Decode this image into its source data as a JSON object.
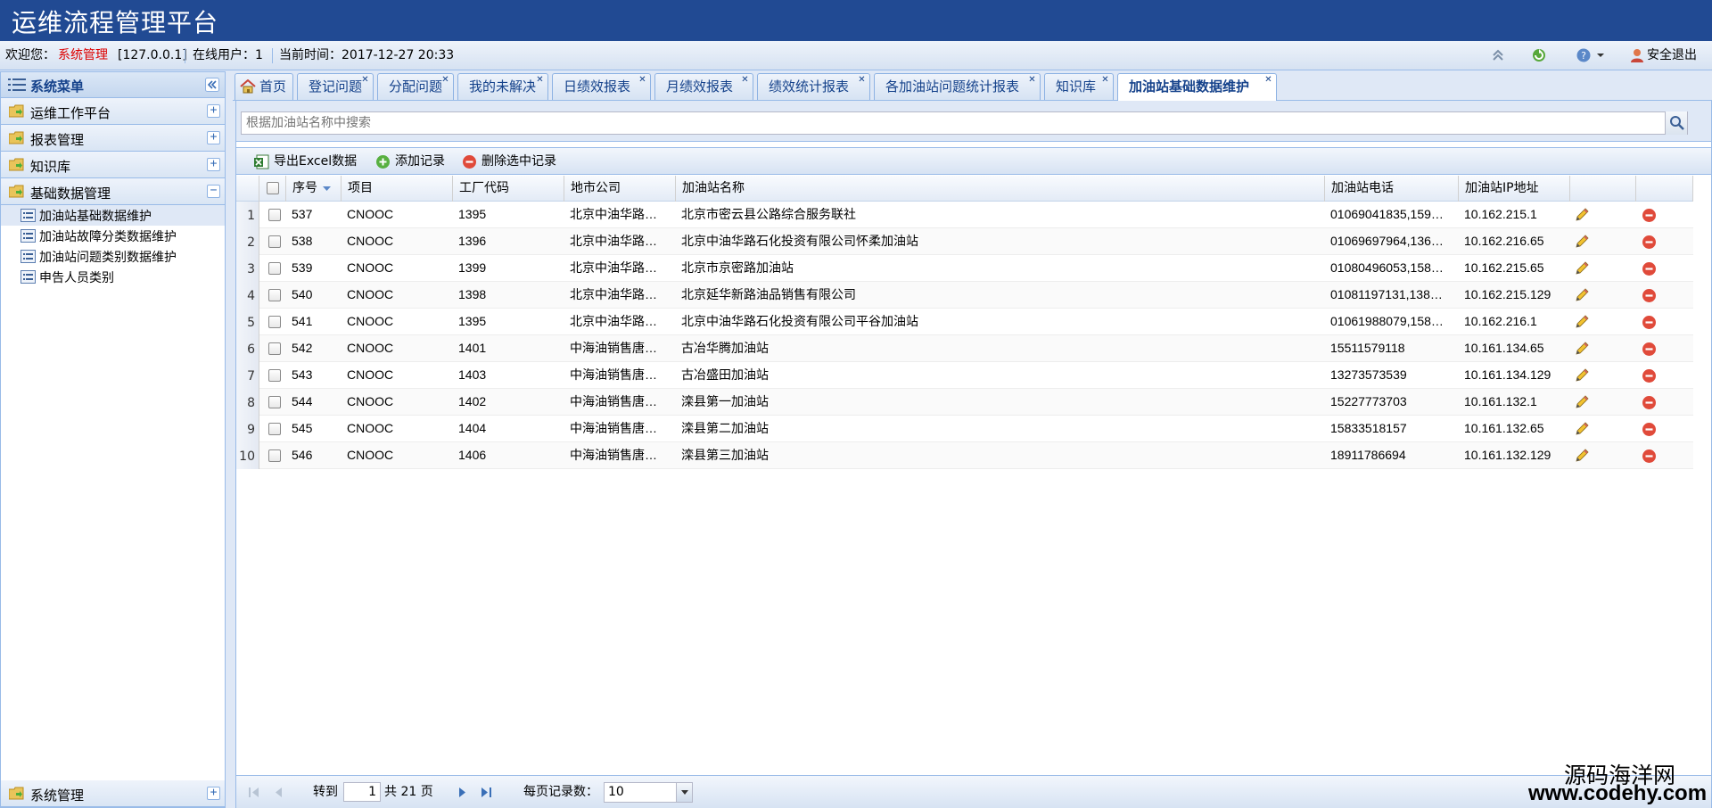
{
  "app": {
    "title": "运维流程管理平台"
  },
  "infobar": {
    "welcome_label": "欢迎您：",
    "user": "系统管理",
    "ip": "[127.0.0.1]",
    "online": "在线用户：1",
    "time": "当前时间：2017-12-27 20:33",
    "logout_label": "安全退出"
  },
  "sidebar": {
    "title": "系统菜单",
    "groups": [
      {
        "label": "运维工作平台",
        "toggle": "+"
      },
      {
        "label": "报表管理",
        "toggle": "+"
      },
      {
        "label": "知识库",
        "toggle": "+"
      },
      {
        "label": "基础数据管理",
        "toggle": "−"
      }
    ],
    "tree": [
      {
        "label": "加油站基础数据维护"
      },
      {
        "label": "加油站故障分类数据维护"
      },
      {
        "label": "加油站问题类别数据维护"
      },
      {
        "label": "申告人员类别"
      }
    ],
    "bottom_group": {
      "label": "系统管理",
      "toggle": "+"
    }
  },
  "tabs": [
    {
      "label": "首页"
    },
    {
      "label": "登记问题"
    },
    {
      "label": "分配问题"
    },
    {
      "label": "我的未解决"
    },
    {
      "label": "日绩效报表"
    },
    {
      "label": "月绩效报表"
    },
    {
      "label": "绩效统计报表"
    },
    {
      "label": "各加油站问题统计报表"
    },
    {
      "label": "知识库"
    },
    {
      "label": "加油站基础数据维护",
      "active": true
    }
  ],
  "search": {
    "placeholder": "根据加油站名称中搜索"
  },
  "toolbar": {
    "export_label": "导出Excel数据",
    "add_label": "添加记录",
    "delete_label": "删除选中记录"
  },
  "grid": {
    "columns": [
      "序号",
      "项目",
      "工厂代码",
      "地市公司",
      "加油站名称",
      "加油站电话",
      "加油站IP地址"
    ],
    "rows": [
      {
        "n": "1",
        "id": "537",
        "proj": "CNOOC",
        "code": "1395",
        "city": "北京中油华路…",
        "name": "北京市密云县公路综合服务联社",
        "phone": "01069041835,159…",
        "ip": "10.162.215.1"
      },
      {
        "n": "2",
        "id": "538",
        "proj": "CNOOC",
        "code": "1396",
        "city": "北京中油华路…",
        "name": "北京中油华路石化投资有限公司怀柔加油站",
        "phone": "01069697964,136…",
        "ip": "10.162.216.65"
      },
      {
        "n": "3",
        "id": "539",
        "proj": "CNOOC",
        "code": "1399",
        "city": "北京中油华路…",
        "name": "北京市京密路加油站",
        "phone": "01080496053,158…",
        "ip": "10.162.215.65"
      },
      {
        "n": "4",
        "id": "540",
        "proj": "CNOOC",
        "code": "1398",
        "city": "北京中油华路…",
        "name": "北京延华新路油品销售有限公司",
        "phone": "01081197131,138…",
        "ip": "10.162.215.129"
      },
      {
        "n": "5",
        "id": "541",
        "proj": "CNOOC",
        "code": "1395",
        "city": "北京中油华路…",
        "name": "北京中油华路石化投资有限公司平谷加油站",
        "phone": "01061988079,158…",
        "ip": "10.162.216.1"
      },
      {
        "n": "6",
        "id": "542",
        "proj": "CNOOC",
        "code": "1401",
        "city": "中海油销售唐…",
        "name": "古冶华腾加油站",
        "phone": "15511579118",
        "ip": "10.161.134.65"
      },
      {
        "n": "7",
        "id": "543",
        "proj": "CNOOC",
        "code": "1403",
        "city": "中海油销售唐…",
        "name": "古冶盛田加油站",
        "phone": "13273573539",
        "ip": "10.161.134.129"
      },
      {
        "n": "8",
        "id": "544",
        "proj": "CNOOC",
        "code": "1402",
        "city": "中海油销售唐…",
        "name": "滦县第一加油站",
        "phone": "15227773703",
        "ip": "10.161.132.1"
      },
      {
        "n": "9",
        "id": "545",
        "proj": "CNOOC",
        "code": "1404",
        "city": "中海油销售唐…",
        "name": "滦县第二加油站",
        "phone": "15833518157",
        "ip": "10.161.132.65"
      },
      {
        "n": "10",
        "id": "546",
        "proj": "CNOOC",
        "code": "1406",
        "city": "中海油销售唐…",
        "name": "滦县第三加油站",
        "phone": "18911786694",
        "ip": "10.161.132.129"
      }
    ]
  },
  "pager": {
    "goto_label": "转到",
    "page": "1",
    "total_label": "共 21 页",
    "pagesize_label": "每页记录数：",
    "pagesize": "10"
  },
  "watermark": {
    "line1": "源码海洋网",
    "line2": "www.codehy.com"
  }
}
